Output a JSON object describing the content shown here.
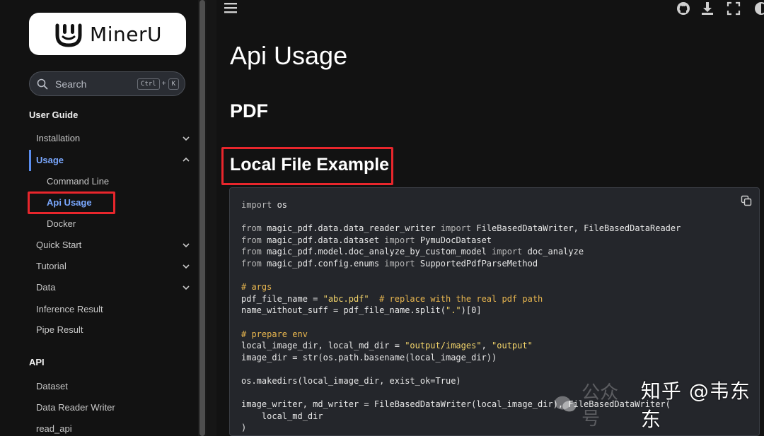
{
  "brand": {
    "name": "MinerU"
  },
  "search": {
    "label": "Search",
    "kbd_ctrl": "Ctrl",
    "kbd_plus": "+",
    "kbd_key": "K"
  },
  "sidebar": {
    "sections": [
      {
        "title": "User Guide"
      },
      {
        "title": "API"
      }
    ],
    "items": [
      {
        "label": "Installation"
      },
      {
        "label": "Usage"
      },
      {
        "label": "Command Line"
      },
      {
        "label": "Api Usage"
      },
      {
        "label": "Docker"
      },
      {
        "label": "Quick Start"
      },
      {
        "label": "Tutorial"
      },
      {
        "label": "Data"
      },
      {
        "label": "Inference Result"
      },
      {
        "label": "Pipe Result"
      },
      {
        "label": "Dataset"
      },
      {
        "label": "Data Reader Writer"
      },
      {
        "label": "read_api"
      }
    ]
  },
  "main": {
    "title": "Api Usage",
    "section": "PDF",
    "subsection": "Local File Example"
  },
  "code": {
    "lines": [
      "import os",
      "",
      "from magic_pdf.data.data_reader_writer import FileBasedDataWriter, FileBasedDataReader",
      "from magic_pdf.data.dataset import PymuDocDataset",
      "from magic_pdf.model.doc_analyze_by_custom_model import doc_analyze",
      "from magic_pdf.config.enums import SupportedPdfParseMethod",
      "",
      "# args",
      "pdf_file_name = \"abc.pdf\"  # replace with the real pdf path",
      "name_without_suff = pdf_file_name.split(\".\")[0]",
      "",
      "# prepare env",
      "local_image_dir, local_md_dir = \"output/images\", \"output\"",
      "image_dir = str(os.path.basename(local_image_dir))",
      "",
      "os.makedirs(local_image_dir, exist_ok=True)",
      "",
      "image_writer, md_writer = FileBasedDataWriter(local_image_dir), FileBasedDataWriter(",
      "    local_md_dir",
      ")"
    ]
  },
  "watermark": {
    "faint": "公众号",
    "text": "知乎 @韦东东"
  },
  "colors": {
    "accent": "#5a8dee",
    "highlight": "#e8262c",
    "background": "#121212",
    "code_bg": "#24262b"
  },
  "icons": [
    "search-icon",
    "hamburger-icon",
    "github-icon",
    "download-icon",
    "fullscreen-icon",
    "theme-toggle-icon",
    "copy-icon",
    "chevron-down-icon",
    "chevron-up-icon"
  ]
}
